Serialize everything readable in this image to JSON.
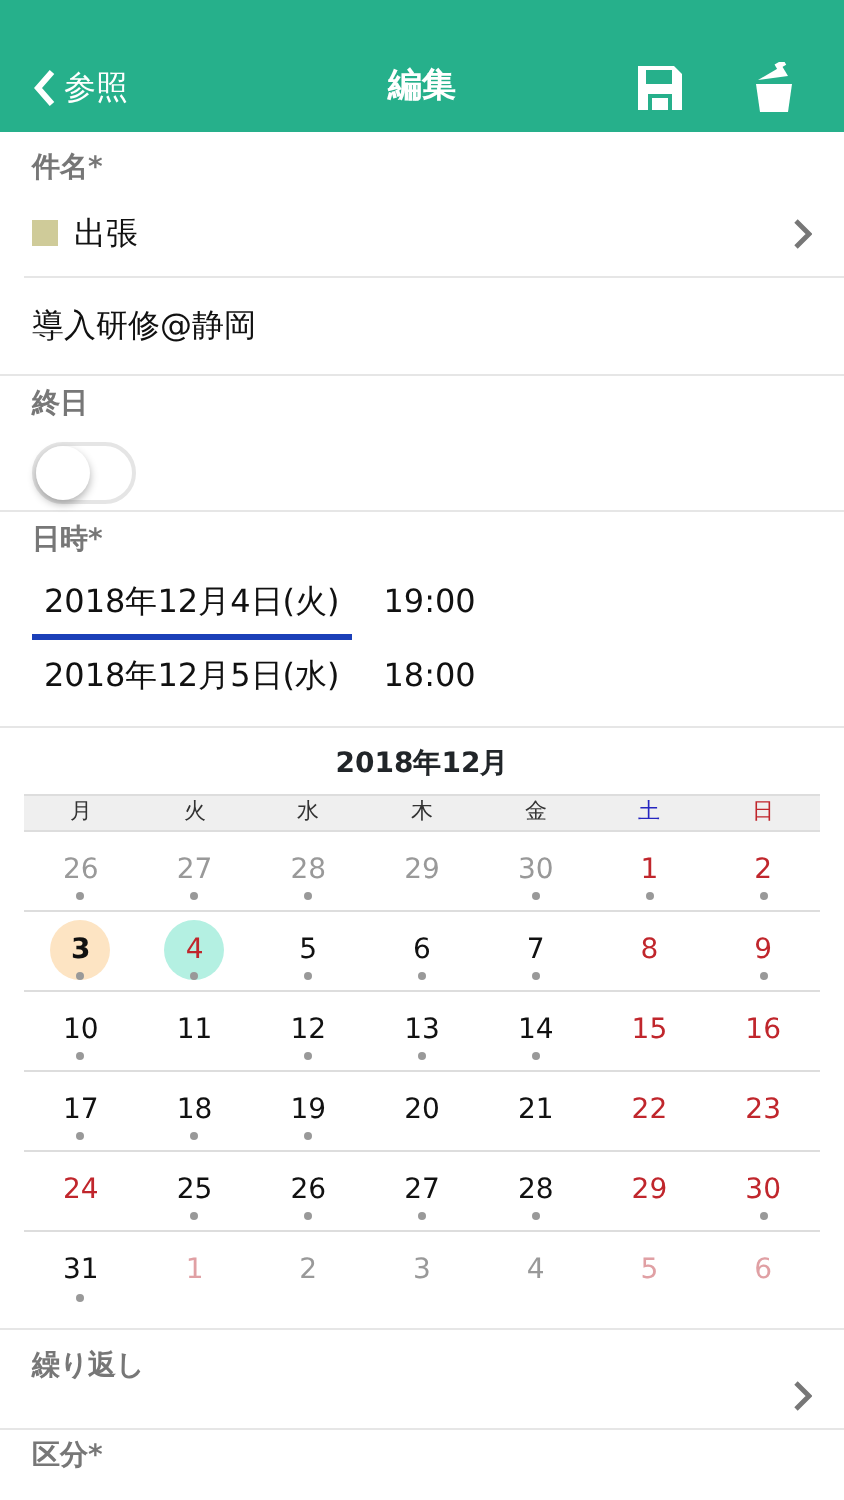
{
  "nav": {
    "back": "参照",
    "title": "編集"
  },
  "subject": {
    "label": "件名*",
    "category": {
      "name": "出張",
      "color": "#cfcb99"
    },
    "title": "導入研修@静岡"
  },
  "all_day": {
    "label": "終日",
    "on": false
  },
  "datetime": {
    "label": "日時*",
    "rows": [
      {
        "date": "2018年12月4日(火)",
        "time": "19:00",
        "selected": true
      },
      {
        "date": "2018年12月5日(水)",
        "time": "18:00",
        "selected": false
      }
    ]
  },
  "calendar": {
    "title": "2018年12月",
    "weekdays": [
      {
        "label": "月",
        "color": "#333333"
      },
      {
        "label": "火",
        "color": "#333333"
      },
      {
        "label": "水",
        "color": "#333333"
      },
      {
        "label": "木",
        "color": "#333333"
      },
      {
        "label": "金",
        "color": "#333333"
      },
      {
        "label": "土",
        "color": "#2626c0"
      },
      {
        "label": "日",
        "color": "#c0262c"
      }
    ],
    "weeks": [
      [
        {
          "day": "26",
          "kind": "other",
          "dot": true
        },
        {
          "day": "27",
          "kind": "other",
          "dot": true
        },
        {
          "day": "28",
          "kind": "other",
          "dot": true
        },
        {
          "day": "29",
          "kind": "other",
          "dot": false
        },
        {
          "day": "30",
          "kind": "other",
          "dot": true
        },
        {
          "day": "1",
          "kind": "holiday",
          "dot": true
        },
        {
          "day": "2",
          "kind": "holiday",
          "dot": true
        }
      ],
      [
        {
          "day": "3",
          "kind": "today",
          "dot": true
        },
        {
          "day": "4",
          "kind": "selected",
          "dot": true
        },
        {
          "day": "5",
          "kind": "weekday",
          "dot": true
        },
        {
          "day": "6",
          "kind": "weekday",
          "dot": true
        },
        {
          "day": "7",
          "kind": "weekday",
          "dot": true
        },
        {
          "day": "8",
          "kind": "holiday",
          "dot": false
        },
        {
          "day": "9",
          "kind": "holiday",
          "dot": true
        }
      ],
      [
        {
          "day": "10",
          "kind": "weekday",
          "dot": true
        },
        {
          "day": "11",
          "kind": "weekday",
          "dot": false
        },
        {
          "day": "12",
          "kind": "weekday",
          "dot": true
        },
        {
          "day": "13",
          "kind": "weekday",
          "dot": true
        },
        {
          "day": "14",
          "kind": "weekday",
          "dot": true
        },
        {
          "day": "15",
          "kind": "holiday",
          "dot": false
        },
        {
          "day": "16",
          "kind": "holiday",
          "dot": false
        }
      ],
      [
        {
          "day": "17",
          "kind": "weekday",
          "dot": true
        },
        {
          "day": "18",
          "kind": "weekday",
          "dot": true
        },
        {
          "day": "19",
          "kind": "weekday",
          "dot": true
        },
        {
          "day": "20",
          "kind": "weekday",
          "dot": false
        },
        {
          "day": "21",
          "kind": "weekday",
          "dot": false
        },
        {
          "day": "22",
          "kind": "holiday",
          "dot": false
        },
        {
          "day": "23",
          "kind": "holiday",
          "dot": false
        }
      ],
      [
        {
          "day": "24",
          "kind": "holiday",
          "dot": false
        },
        {
          "day": "25",
          "kind": "weekday",
          "dot": true
        },
        {
          "day": "26",
          "kind": "weekday",
          "dot": true
        },
        {
          "day": "27",
          "kind": "weekday",
          "dot": true
        },
        {
          "day": "28",
          "kind": "weekday",
          "dot": true
        },
        {
          "day": "29",
          "kind": "holiday",
          "dot": false
        },
        {
          "day": "30",
          "kind": "holiday",
          "dot": true
        }
      ],
      [
        {
          "day": "31",
          "kind": "weekday",
          "dot": true
        },
        {
          "day": "1",
          "kind": "other-holiday",
          "dot": false
        },
        {
          "day": "2",
          "kind": "other",
          "dot": false
        },
        {
          "day": "3",
          "kind": "other",
          "dot": false
        },
        {
          "day": "4",
          "kind": "other",
          "dot": false
        },
        {
          "day": "5",
          "kind": "other-holiday",
          "dot": false
        },
        {
          "day": "6",
          "kind": "other-holiday",
          "dot": false
        }
      ]
    ]
  },
  "repeat": {
    "label": "繰り返し"
  },
  "next_label": "区分*"
}
